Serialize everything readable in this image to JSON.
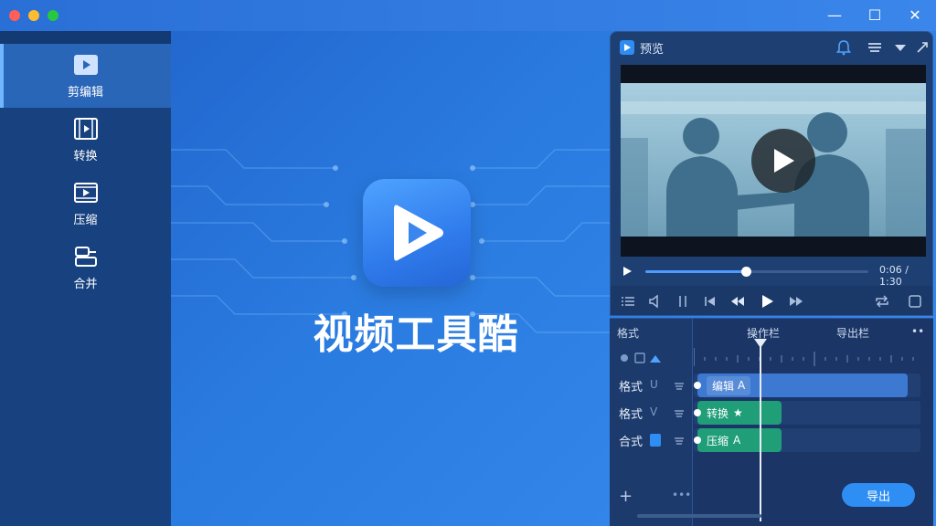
{
  "app": {
    "title": "视频工具酷"
  },
  "window_controls": {
    "minimize": "—",
    "maximize": "☐",
    "close": "✕"
  },
  "sidebar": {
    "items": [
      {
        "label": "剪编辑",
        "icon": "play-square-icon",
        "active": true
      },
      {
        "label": "转换",
        "icon": "film-play-icon",
        "active": false
      },
      {
        "label": "压缩",
        "icon": "film-compress-icon",
        "active": false
      },
      {
        "label": "合并",
        "icon": "merge-icon",
        "active": false
      }
    ]
  },
  "player": {
    "title": "预览",
    "time": "0:06 / 1:30",
    "progress": 0.45
  },
  "timeline": {
    "headers": {
      "left": "格式",
      "mid": "操作栏",
      "right": "导出栏",
      "more": "••"
    },
    "tracks": [
      {
        "label": "格式",
        "sub": "U",
        "clip": "编辑",
        "clip_icon": "A"
      },
      {
        "label": "格式",
        "sub": "V",
        "clip": "转换",
        "clip_icon": "★"
      },
      {
        "label": "合式",
        "sub": "",
        "clip": "压缩",
        "clip_icon": "A"
      }
    ],
    "add_label": "+",
    "extra_dots": "•••",
    "export_label": "导出"
  },
  "colors": {
    "accent": "#2f8ef4",
    "sidebar": "#17427f",
    "clip_blue": "#3d78d1",
    "clip_green": "#1f9e77"
  }
}
